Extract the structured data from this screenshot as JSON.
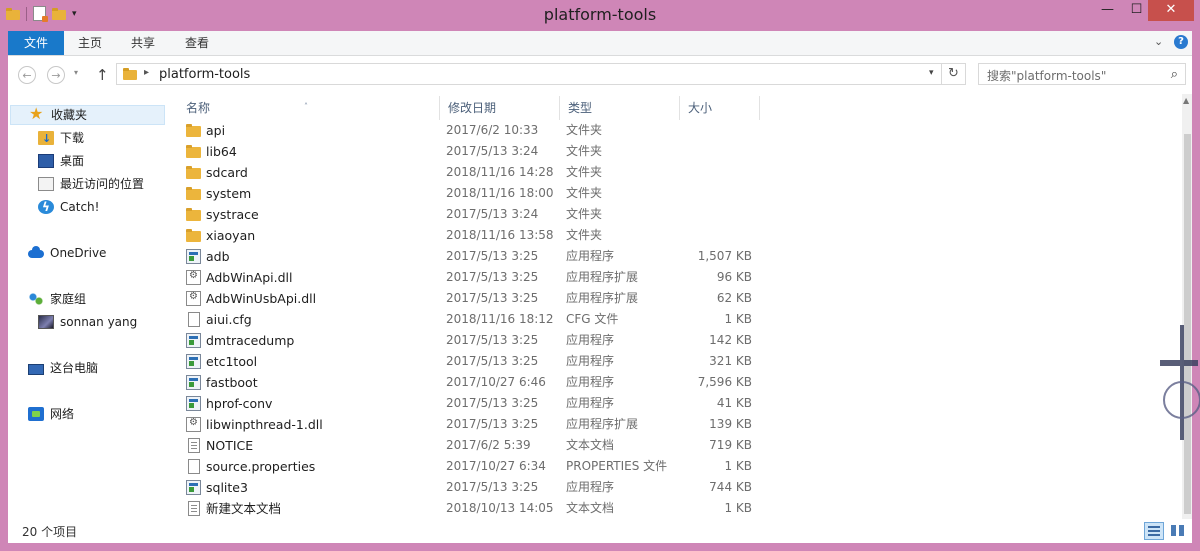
{
  "window": {
    "title": "platform-tools",
    "minimize_glyph": "—",
    "maximize_glyph": "☐",
    "close_glyph": "✕"
  },
  "ribbon": {
    "tabs": [
      "文件",
      "主页",
      "共享",
      "查看"
    ],
    "collapse_glyph": "⌄",
    "help_glyph": "?"
  },
  "address": {
    "path_segment": "platform-tools",
    "search_placeholder": "搜索\"platform-tools\"",
    "back_glyph": "←",
    "forward_glyph": "→",
    "recent_glyph": "▾",
    "up_glyph": "↑",
    "chevron_glyph": "▸",
    "dropdown_glyph": "▾",
    "refresh_glyph": "↻",
    "search_glyph": "⌕"
  },
  "nav_pane": {
    "items": [
      {
        "label": "收藏夹",
        "icon": "star-icon"
      },
      {
        "label": "下载",
        "icon": "download-folder-icon"
      },
      {
        "label": "桌面",
        "icon": "desktop-icon"
      },
      {
        "label": "最近访问的位置",
        "icon": "recent-places-icon"
      },
      {
        "label": "Catch!",
        "icon": "catch-icon"
      },
      {
        "label": "OneDrive",
        "icon": "onedrive-cloud-icon"
      },
      {
        "label": "家庭组",
        "icon": "homegroup-icon"
      },
      {
        "label": "sonnan yang",
        "icon": "user-avatar-icon"
      },
      {
        "label": "这台电脑",
        "icon": "this-pc-icon"
      },
      {
        "label": "网络",
        "icon": "network-icon"
      }
    ]
  },
  "file_list": {
    "columns": [
      "名称",
      "修改日期",
      "类型",
      "大小"
    ],
    "sort_glyph": "˄",
    "rows": [
      {
        "name": "api",
        "date": "2017/6/2 10:33",
        "type": "文件夹",
        "size": "",
        "icon": "folder-icon"
      },
      {
        "name": "lib64",
        "date": "2017/5/13 3:24",
        "type": "文件夹",
        "size": "",
        "icon": "folder-icon"
      },
      {
        "name": "sdcard",
        "date": "2018/11/16 14:28",
        "type": "文件夹",
        "size": "",
        "icon": "folder-icon"
      },
      {
        "name": "system",
        "date": "2018/11/16 18:00",
        "type": "文件夹",
        "size": "",
        "icon": "folder-icon"
      },
      {
        "name": "systrace",
        "date": "2017/5/13 3:24",
        "type": "文件夹",
        "size": "",
        "icon": "folder-icon"
      },
      {
        "name": "xiaoyan",
        "date": "2018/11/16 13:58",
        "type": "文件夹",
        "size": "",
        "icon": "folder-icon"
      },
      {
        "name": "adb",
        "date": "2017/5/13 3:25",
        "type": "应用程序",
        "size": "1,507 KB",
        "icon": "exe-icon"
      },
      {
        "name": "AdbWinApi.dll",
        "date": "2017/5/13 3:25",
        "type": "应用程序扩展",
        "size": "96 KB",
        "icon": "dll-icon"
      },
      {
        "name": "AdbWinUsbApi.dll",
        "date": "2017/5/13 3:25",
        "type": "应用程序扩展",
        "size": "62 KB",
        "icon": "dll-icon"
      },
      {
        "name": "aiui.cfg",
        "date": "2018/11/16 18:12",
        "type": "CFG 文件",
        "size": "1 KB",
        "icon": "file-icon"
      },
      {
        "name": "dmtracedump",
        "date": "2017/5/13 3:25",
        "type": "应用程序",
        "size": "142 KB",
        "icon": "exe-icon"
      },
      {
        "name": "etc1tool",
        "date": "2017/5/13 3:25",
        "type": "应用程序",
        "size": "321 KB",
        "icon": "exe-icon"
      },
      {
        "name": "fastboot",
        "date": "2017/10/27 6:46",
        "type": "应用程序",
        "size": "7,596 KB",
        "icon": "exe-icon"
      },
      {
        "name": "hprof-conv",
        "date": "2017/5/13 3:25",
        "type": "应用程序",
        "size": "41 KB",
        "icon": "exe-icon"
      },
      {
        "name": "libwinpthread-1.dll",
        "date": "2017/5/13 3:25",
        "type": "应用程序扩展",
        "size": "139 KB",
        "icon": "dll-icon"
      },
      {
        "name": "NOTICE",
        "date": "2017/6/2 5:39",
        "type": "文本文档",
        "size": "719 KB",
        "icon": "text-file-icon"
      },
      {
        "name": "source.properties",
        "date": "2017/10/27 6:34",
        "type": "PROPERTIES 文件",
        "size": "1 KB",
        "icon": "file-icon"
      },
      {
        "name": "sqlite3",
        "date": "2017/5/13 3:25",
        "type": "应用程序",
        "size": "744 KB",
        "icon": "exe-icon"
      },
      {
        "name": "新建文本文档",
        "date": "2018/10/13 14:05",
        "type": "文本文档",
        "size": "1 KB",
        "icon": "text-file-icon"
      }
    ]
  },
  "status": {
    "item_count": "20 个项目"
  },
  "colors": {
    "window_frame": "#cf86b7",
    "file_tab": "#1979ca",
    "close_button": "#c7504c",
    "folder": "#ecb53c"
  }
}
